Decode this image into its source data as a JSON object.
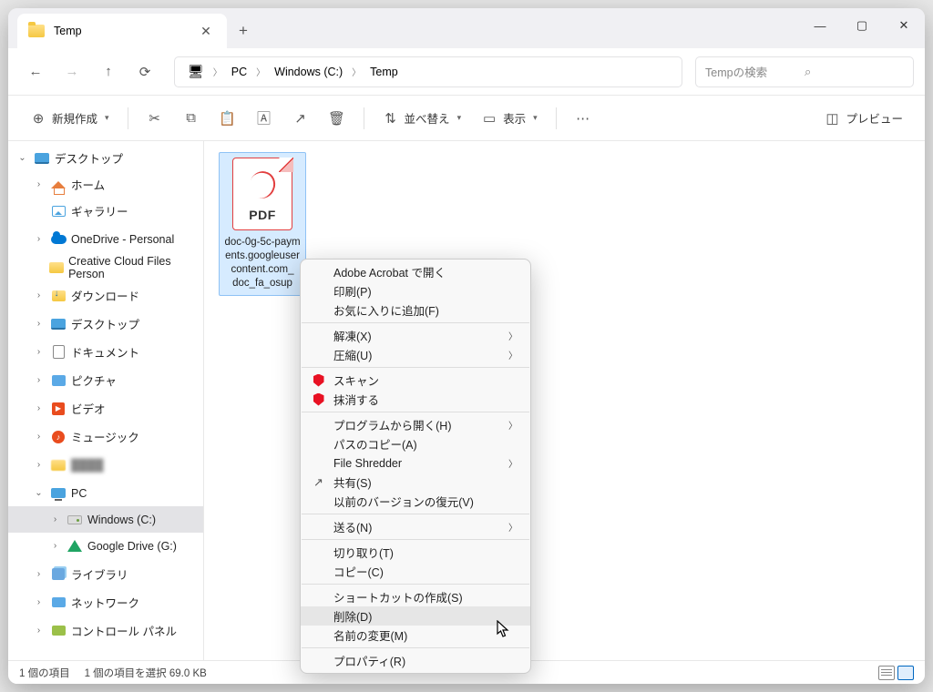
{
  "tab": {
    "title": "Temp"
  },
  "breadcrumb": [
    "PC",
    "Windows (C:)",
    "Temp"
  ],
  "search": {
    "placeholder": "Tempの検索"
  },
  "toolbar": {
    "new": "新規作成",
    "sort": "並べ替え",
    "view": "表示",
    "preview": "プレビュー"
  },
  "sidebar": [
    {
      "icon": "desktop",
      "label": "デスクトップ",
      "chev": "down",
      "indent": 0
    },
    {
      "icon": "home",
      "label": "ホーム",
      "chev": "right",
      "indent": 1
    },
    {
      "icon": "gallery",
      "label": "ギャラリー",
      "chev": "",
      "indent": 1
    },
    {
      "icon": "cloud",
      "label": "OneDrive - Personal",
      "chev": "right",
      "indent": 1,
      "space": true
    },
    {
      "icon": "ccf",
      "label": "Creative Cloud Files Person",
      "chev": "",
      "indent": 1,
      "space": true
    },
    {
      "icon": "dl",
      "label": "ダウンロード",
      "chev": "right",
      "indent": 1,
      "space": true
    },
    {
      "icon": "desktop",
      "label": "デスクトップ",
      "chev": "right",
      "indent": 1,
      "space": true
    },
    {
      "icon": "doc",
      "label": "ドキュメント",
      "chev": "right",
      "indent": 1,
      "space": true
    },
    {
      "icon": "pic",
      "label": "ピクチャ",
      "chev": "right",
      "indent": 1,
      "space": true
    },
    {
      "icon": "video",
      "label": "ビデオ",
      "chev": "right",
      "indent": 1,
      "space": true
    },
    {
      "icon": "music",
      "label": "ミュージック",
      "chev": "right",
      "indent": 1,
      "space": true
    },
    {
      "icon": "blur",
      "label": "",
      "chev": "right",
      "indent": 1,
      "space": true,
      "blur": true
    },
    {
      "icon": "pc",
      "label": "PC",
      "chev": "down",
      "indent": 1,
      "space": true
    },
    {
      "icon": "drive",
      "label": "Windows (C:)",
      "chev": "right",
      "indent": 2,
      "selected": true
    },
    {
      "icon": "gdrive",
      "label": "Google Drive (G:)",
      "chev": "right",
      "indent": 2
    },
    {
      "icon": "lib",
      "label": "ライブラリ",
      "chev": "right",
      "indent": 1,
      "space": true
    },
    {
      "icon": "net",
      "label": "ネットワーク",
      "chev": "right",
      "indent": 1,
      "space": true
    },
    {
      "icon": "cp",
      "label": "コントロール パネル",
      "chev": "right",
      "indent": 1,
      "space": true
    }
  ],
  "file": {
    "big_label": "PDF",
    "name": "doc-0g-5c-paym​ents.googleuserc​ontent.com_​doc_fa_osup"
  },
  "context_menu": {
    "groups": [
      [
        {
          "label": "Adobe Acrobat で開く"
        },
        {
          "label": "印刷(P)"
        },
        {
          "label": "お気に入りに追加(F)"
        }
      ],
      [
        {
          "label": "解凍(X)",
          "arrow": true
        },
        {
          "label": "圧縮(U)",
          "arrow": true
        }
      ],
      [
        {
          "label": "スキャン",
          "icon": "mshield"
        },
        {
          "label": "抹消する",
          "icon": "mshield"
        }
      ],
      [
        {
          "label": "プログラムから開く(H)",
          "arrow": true
        },
        {
          "label": "パスのコピー(A)"
        },
        {
          "label": "File Shredder",
          "arrow": true
        },
        {
          "label": "共有(S)",
          "icon": "share"
        },
        {
          "label": "以前のバージョンの復元(V)"
        }
      ],
      [
        {
          "label": "送る(N)",
          "arrow": true
        }
      ],
      [
        {
          "label": "切り取り(T)"
        },
        {
          "label": "コピー(C)"
        }
      ],
      [
        {
          "label": "ショートカットの作成(S)"
        },
        {
          "label": "削除(D)",
          "hover": true
        },
        {
          "label": "名前の変更(M)"
        }
      ],
      [
        {
          "label": "プロパティ(R)"
        }
      ]
    ]
  },
  "status": {
    "count": "1 個の項目",
    "selected": "1 個の項目を選択 69.0 KB"
  }
}
